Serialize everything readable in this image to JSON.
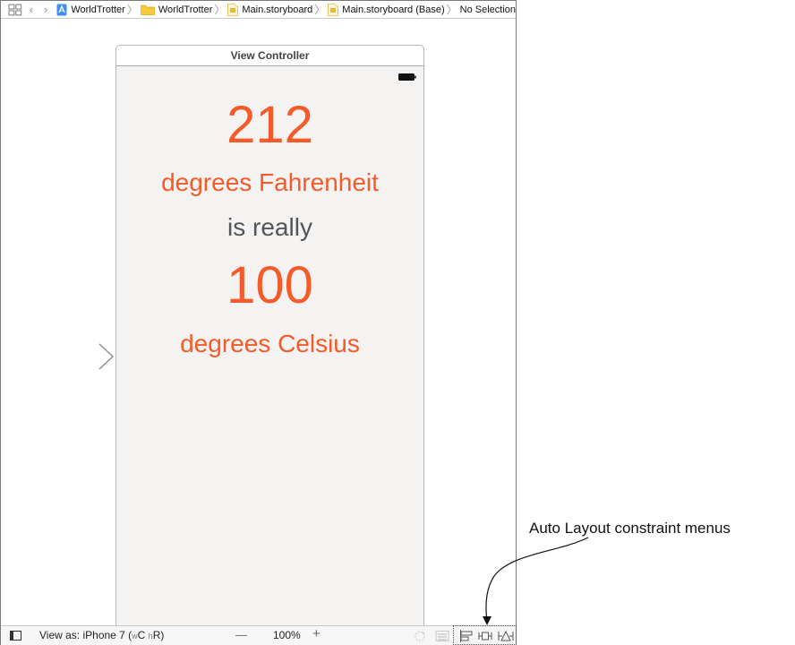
{
  "jumpbar": {
    "crumbs": [
      "WorldTrotter",
      "WorldTrotter",
      "Main.storyboard",
      "Main.storyboard (Base)",
      "No Selection"
    ]
  },
  "scene": {
    "title": "View Controller",
    "fahrenheit_value": "212",
    "fahrenheit_unit": "degrees Fahrenheit",
    "connector": "is really",
    "celsius_value": "100",
    "celsius_unit": "degrees Celsius"
  },
  "bottombar": {
    "view_as_label": "View as: iPhone 7 (",
    "view_as_w": "w",
    "view_as_c": "C ",
    "view_as_h": "h",
    "view_as_r": "R)",
    "zoom_out": "—",
    "zoom": "100%",
    "zoom_in": "+"
  },
  "annotation": {
    "text": "Auto Layout constraint menus"
  },
  "colors": {
    "accent_orange": "#f45a2a",
    "text_dark": "#555555",
    "scene_background": "#f4f3f1"
  }
}
